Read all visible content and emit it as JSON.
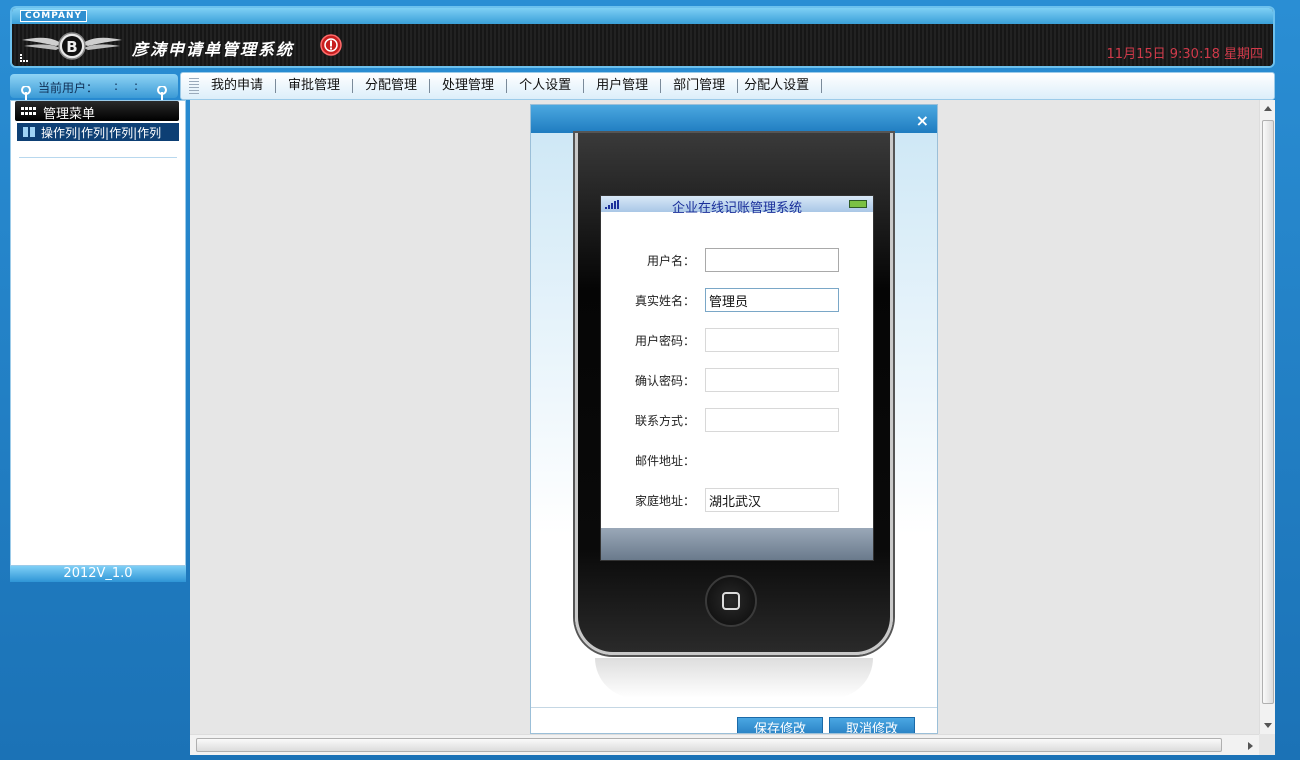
{
  "header": {
    "company_badge": "COMPANY",
    "app_title": "彦涛申请单管理系统",
    "datetime": "11月15日 9:30:18 星期四",
    "logo_letter": "B"
  },
  "user_box": {
    "label": "当前用户：",
    "value": ""
  },
  "nav": {
    "items": [
      "我的申请",
      "审批管理",
      "分配管理",
      "处理管理",
      "个人设置",
      "用户管理",
      "部门管理",
      "分配人设置"
    ]
  },
  "sidebar": {
    "menu_header": "管理菜单",
    "menu_item": "操作列|作列|作列|作列",
    "version": "2012V_1.0"
  },
  "dialog": {
    "close_glyph": "×",
    "phone_title": "企业在线记账管理系统",
    "fields": [
      {
        "label": "用户名：",
        "value": ""
      },
      {
        "label": "真实姓名：",
        "value": "管理员"
      },
      {
        "label": "用户密码：",
        "value": ""
      },
      {
        "label": "确认密码：",
        "value": ""
      },
      {
        "label": "联系方式：",
        "value": ""
      },
      {
        "label": "邮件地址：",
        "value": ""
      },
      {
        "label": "家庭地址：",
        "value": "湖北武汉"
      }
    ],
    "save_label": "保存修改",
    "cancel_label": "取消修改"
  },
  "colors": {
    "frame_blue": "#1e7fc2",
    "datetime_red": "#d03a4a",
    "phone_title_blue": "#1a2f9a"
  }
}
